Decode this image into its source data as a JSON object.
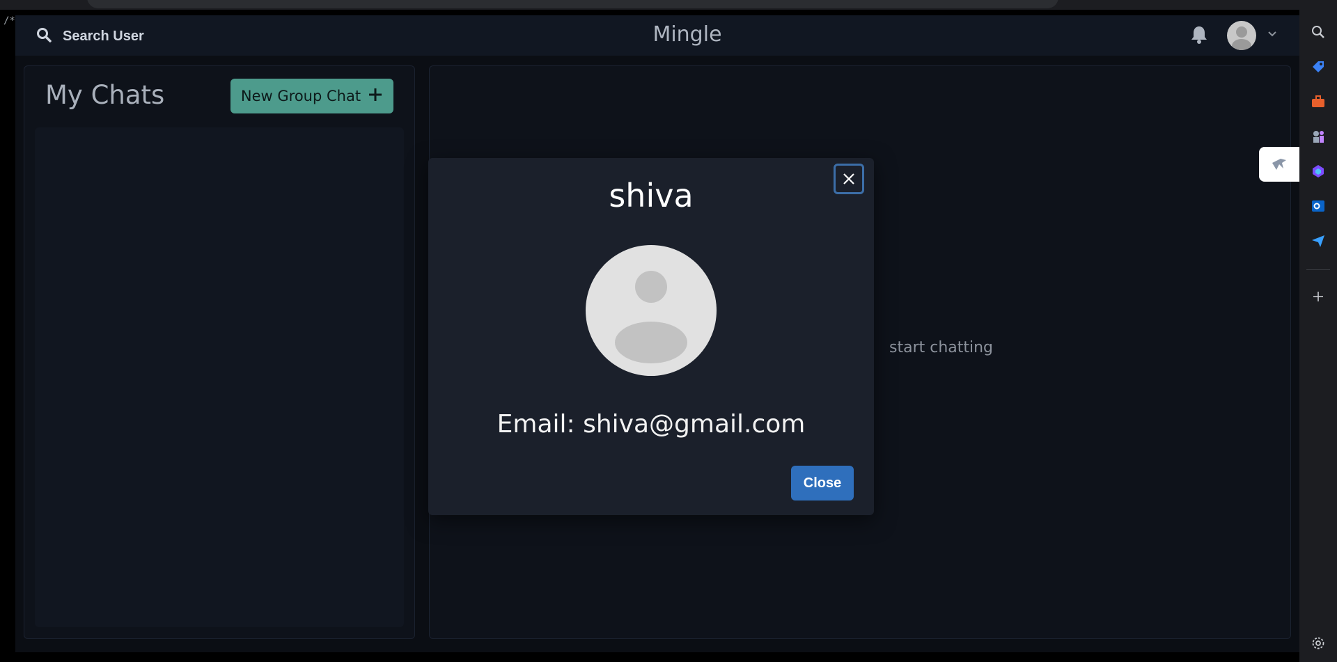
{
  "header": {
    "search_label": "Search User",
    "brand": "Mingle"
  },
  "editor_fragment": "/*",
  "chats": {
    "title": "My Chats",
    "new_group_label": "New Group Chat"
  },
  "chat_area": {
    "hint_text": "start chatting"
  },
  "profile_modal": {
    "name": "shiva",
    "email_text": "Email: shiva@gmail.com",
    "close_label": "Close"
  },
  "colors": {
    "accent_teal": "#4d9b8c",
    "primary_blue": "#2f6fbc",
    "modal_bg": "#1b202b"
  },
  "icons": [
    "search-icon",
    "bell-icon",
    "user-avatar",
    "chevron-down-icon",
    "plus-icon",
    "close-icon",
    "edge-search-icon",
    "shopping-tag-icon",
    "toolbox-icon",
    "chess-icon",
    "copilot-icon",
    "outlook-icon",
    "send-icon",
    "add-icon",
    "settings-icon",
    "floating-app-icon"
  ]
}
